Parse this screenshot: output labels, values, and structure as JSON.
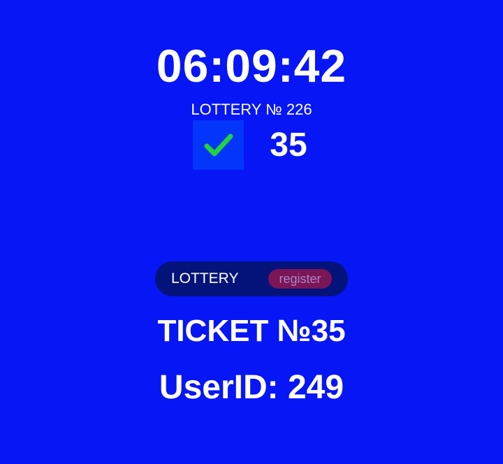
{
  "countdown": {
    "time": "06:09:42"
  },
  "lottery": {
    "label": "LOTTERY № 226",
    "status_icon": "checkmark-icon",
    "status_icon_color": "#22d33c",
    "ticket_count": "35"
  },
  "lottery_bar": {
    "label": "LOTTERY",
    "register_label": "register"
  },
  "ticket": {
    "title": "TICKET №35",
    "user_id": "UserID: 249"
  },
  "colors": {
    "background": "#0616f5",
    "checkbox_background": "#0435fb",
    "pill_background": "#04137a",
    "register_background": "#7a1557",
    "register_text": "#a987c4"
  }
}
